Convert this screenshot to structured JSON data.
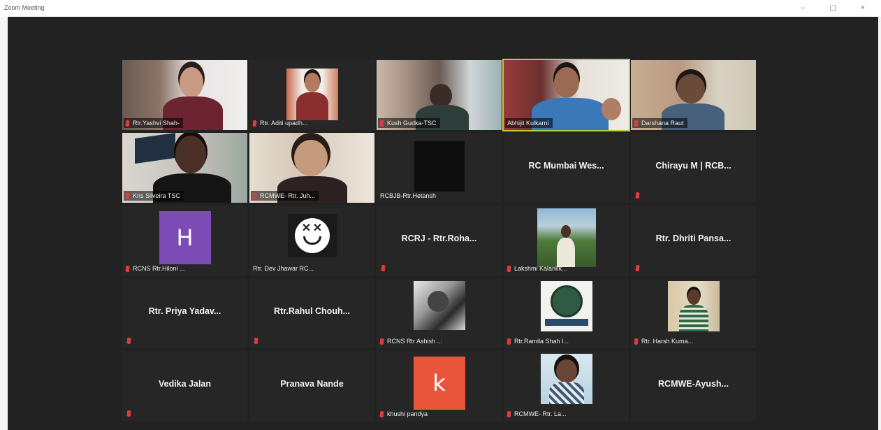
{
  "window": {
    "title": "Zoom Meeting",
    "controls": {
      "minimize": "–",
      "maximize": "▢",
      "close": "×"
    }
  },
  "colors": {
    "meeting_bg": "#222222",
    "active_speaker_border": "#b5d335",
    "muted_mic": "#e0393e"
  },
  "participants": [
    {
      "name": "Rtr.Yashvi Shah-",
      "kind": "video",
      "muted": true
    },
    {
      "name": "Rtr. Aditi upadh...",
      "kind": "video",
      "muted": true
    },
    {
      "name": "Kush Gudka-TSC",
      "kind": "video",
      "muted": true
    },
    {
      "name": "Abhijit Kulkarni",
      "kind": "video",
      "muted": false,
      "active_speaker": true
    },
    {
      "name": "Darshana Raut",
      "kind": "video",
      "muted": true
    },
    {
      "name": "Kris Silveira TSC",
      "kind": "video",
      "muted": true
    },
    {
      "name": "RCMWE- Rtr. Juh...",
      "kind": "video",
      "muted": true
    },
    {
      "name": "RCBJB-Rtr.Hetansh",
      "kind": "video",
      "muted": false
    },
    {
      "name": "RC Mumbai Wes...",
      "kind": "name-only",
      "muted": false
    },
    {
      "name": "Chirayu M | RCB...",
      "kind": "name-only",
      "muted": true
    },
    {
      "name": "RCNS  Rtr.Hiloni ...",
      "kind": "avatar-letter",
      "avatar_letter": "H",
      "avatar_color": "#7c4bb5",
      "muted": true
    },
    {
      "name": "Rtr. Dev Jhawar RC...",
      "kind": "avatar-image",
      "avatar_icon": "marshmello-icon",
      "muted": false
    },
    {
      "name": "RCRJ - Rtr.Roha...",
      "kind": "name-only",
      "muted": true
    },
    {
      "name": "Lakshmi Kalankk...",
      "kind": "avatar-photo",
      "muted": true
    },
    {
      "name": "Rtr. Dhriti Pansa...",
      "kind": "name-only",
      "muted": true
    },
    {
      "name": "Rtr. Priya Yadav...",
      "kind": "name-only",
      "muted": true
    },
    {
      "name": "Rtr.Rahul  Chouh...",
      "kind": "name-only",
      "muted": true
    },
    {
      "name": "RCNS Rtr Ashish ...",
      "kind": "avatar-photo",
      "muted": true
    },
    {
      "name": "Rtr.Ramila Shah I...",
      "kind": "avatar-photo",
      "muted": true
    },
    {
      "name": "Rtr. Harsh Kuma...",
      "kind": "avatar-photo",
      "muted": true
    },
    {
      "name": "Vedika Jalan",
      "kind": "name-only",
      "muted": true
    },
    {
      "name": "Pranava Nande",
      "kind": "name-only",
      "muted": false
    },
    {
      "name": "khushi pandya",
      "kind": "avatar-letter",
      "avatar_letter": "k",
      "avatar_color": "#e8553a",
      "muted": true
    },
    {
      "name": "RCMWE- Rtr. La...",
      "kind": "avatar-photo",
      "muted": true
    },
    {
      "name": "RCMWE-Ayush...",
      "kind": "name-only",
      "muted": false
    }
  ]
}
